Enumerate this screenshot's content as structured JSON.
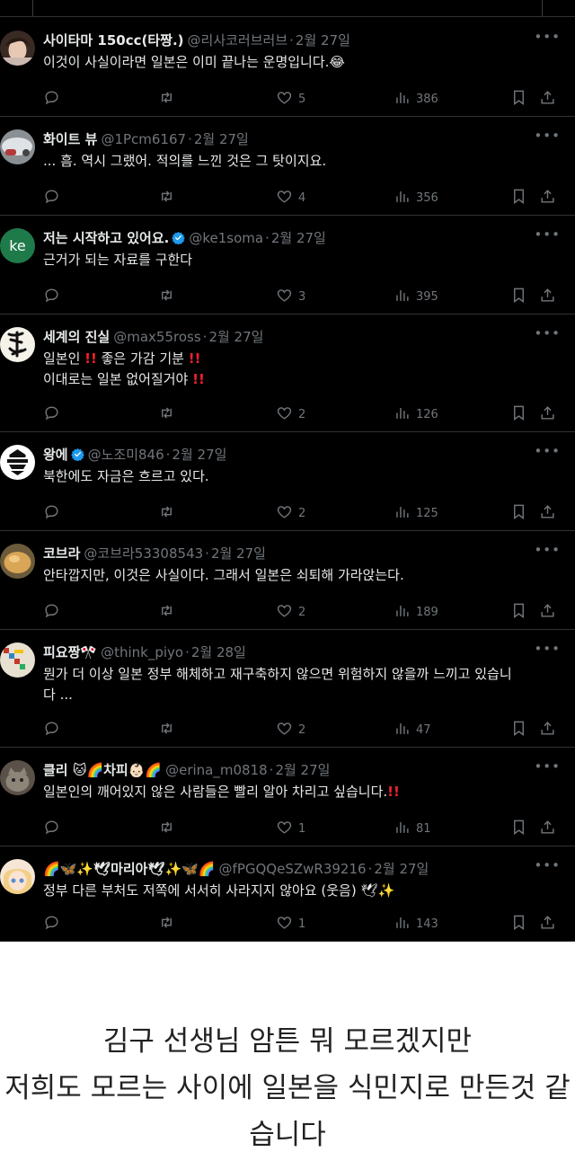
{
  "tweets": [
    {
      "name": "사이타마 150cc(타짱.)",
      "handle": "@리사코러브러브",
      "date": "2월 27일",
      "lines": [
        "이것이 사실이라면 일본은 이미 끝나는 운명입니다.😂"
      ],
      "reply": "",
      "retweet": "",
      "like": "5",
      "views": "386",
      "avatar": "woman-photo-avatar"
    },
    {
      "name": "화이트 뷰",
      "handle": "@1Pcm6167",
      "date": "2월 27일",
      "lines": [
        "... 흠. 역시 그랬어. 적의를 느낀 것은 그 탓이지요."
      ],
      "reply": "",
      "retweet": "",
      "like": "4",
      "views": "356",
      "avatar": "car-photo-avatar"
    },
    {
      "name": "저는 시작하고 있어요.",
      "verified": true,
      "handle": "@ke1soma",
      "date": "2월 27일",
      "lines": [
        "근거가 되는 자료를 구한다"
      ],
      "reply": "",
      "retweet": "",
      "like": "3",
      "views": "395",
      "avatar": "ke-letter-avatar",
      "avatar_text": "ke"
    },
    {
      "name": "세계의 진실",
      "handle": "@max55ross",
      "date": "2월 27일",
      "lines": [
        "일본인 ‼️ 좋은 가감 기분 ‼️",
        "이대로는 일본 없어질거야 ‼️"
      ],
      "reply": "",
      "retweet": "",
      "like": "2",
      "views": "126",
      "avatar": "calligraphy-avatar"
    },
    {
      "name": "왕에",
      "verified": true,
      "handle": "@노조미846",
      "date": "2월 27일",
      "lines": [
        "북한에도 자금은 흐르고 있다."
      ],
      "reply": "",
      "retweet": "",
      "like": "2",
      "views": "125",
      "avatar": "emblem-avatar"
    },
    {
      "name": "코브라",
      "handle": "@코브라53308543",
      "date": "2월 27일",
      "lines": [
        "안타깝지만, 이것은 사실이다. 그래서 일본은 쇠퇴해 가라앉는다."
      ],
      "reply": "",
      "retweet": "",
      "like": "2",
      "views": "189",
      "avatar": "bread-photo-avatar"
    },
    {
      "name": "피요짱🎌",
      "handle": "@think_piyo",
      "date": "2월 28일",
      "lines": [
        "뭔가 더 이상 일본 정부 해체하고 재구축하지 않으면 위험하지 않을까 느끼고 있습니",
        "다 ..."
      ],
      "reply": "",
      "retweet": "",
      "like": "2",
      "views": "47",
      "avatar": "bird-art-avatar"
    },
    {
      "name": "클리 🐱🌈차피👶🏻🌈",
      "handle": "@erina_m0818",
      "date": "2월 27일",
      "lines": [
        "일본인의 깨어있지 않은 사람들은 빨리 알아 차리고 싶습니다.‼️"
      ],
      "reply": "",
      "retweet": "",
      "like": "1",
      "views": "81",
      "avatar": "cat-photo-avatar"
    },
    {
      "name": "🌈🦋✨🕊마리아🕊✨🦋🌈",
      "handle": "@fPGQQeSZwR39216",
      "date": "2월 27일",
      "lines": [
        "정부 다른 부처도 저쪽에 서서히 사라지지 않아요 (웃음) 🕊✨"
      ],
      "reply": "",
      "retweet": "",
      "like": "1",
      "views": "143",
      "avatar": "anime-girl-avatar"
    }
  ],
  "caption": {
    "lines": [
      "김구 선생님 암튼 뭐 모르겠지만",
      "저희도 모르는 사이에 일본을 식민지로 만든것 같",
      "습니다"
    ]
  },
  "colors": {
    "background": "#000000",
    "text": "#e7e9ea",
    "muted": "#71767b",
    "divider": "#2f3336",
    "verified": "#1d9bf0",
    "caption_bg": "#ffffff"
  }
}
